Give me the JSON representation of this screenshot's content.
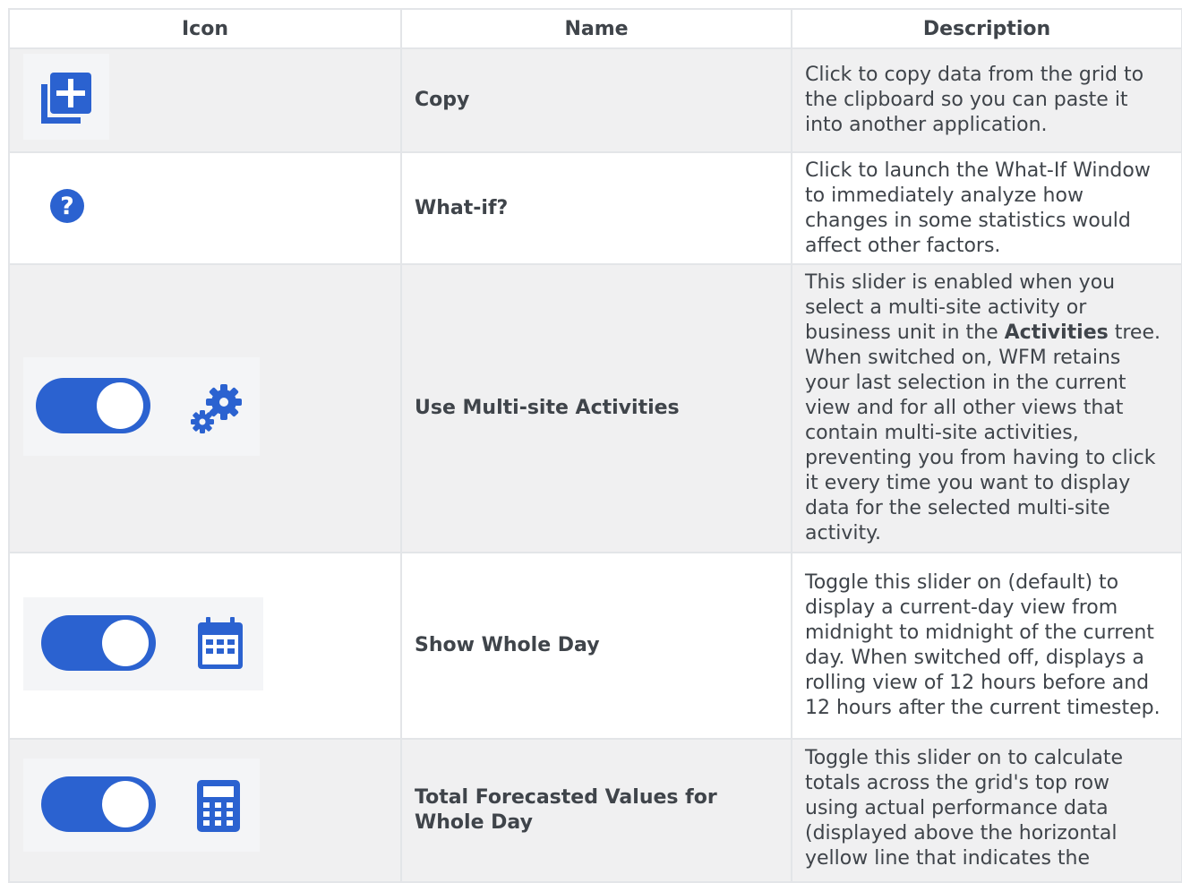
{
  "table": {
    "headers": {
      "icon": "Icon",
      "name": "Name",
      "description": "Description"
    },
    "rows": [
      {
        "icons": [
          "copy-icon"
        ],
        "name": "Copy",
        "description": "Click to copy data from the grid to the clipboard so you can paste it into another application."
      },
      {
        "icons": [
          "question-circle-icon"
        ],
        "name": "What-if?",
        "description": "Click to launch the What-If Window to immediately analyze how changes in some statistics would affect other factors."
      },
      {
        "icons": [
          "toggle-switch-icon",
          "gears-icon"
        ],
        "name": "Use Multi-site Activities",
        "description_before": "This slider is enabled when you select a multi-site activity or business unit in the ",
        "description_bold": "Activities",
        "description_after": " tree. When switched on, WFM retains your last selection in the current view and for all other views that contain multi-site activities, preventing you from having to click it every time you want to display data for the selected multi-site activity."
      },
      {
        "icons": [
          "toggle-switch-icon",
          "calendar-icon"
        ],
        "name": "Show Whole Day",
        "description": "Toggle this slider on (default) to display a current-day view from midnight to midnight of the current day. When switched off, displays a rolling view of 12 hours before and 12 hours after the current timestep."
      },
      {
        "icons": [
          "toggle-switch-icon",
          "calculator-icon"
        ],
        "name": "Total Forecasted Values for Whole Day",
        "description": "Toggle this slider on to calculate totals across the grid's top row using actual performance data (displayed above the horizontal yellow line that indicates the"
      }
    ]
  },
  "colors": {
    "accent": "#2b62d0",
    "row_shade": "#f0f0f1",
    "border": "#e3e5e8"
  }
}
